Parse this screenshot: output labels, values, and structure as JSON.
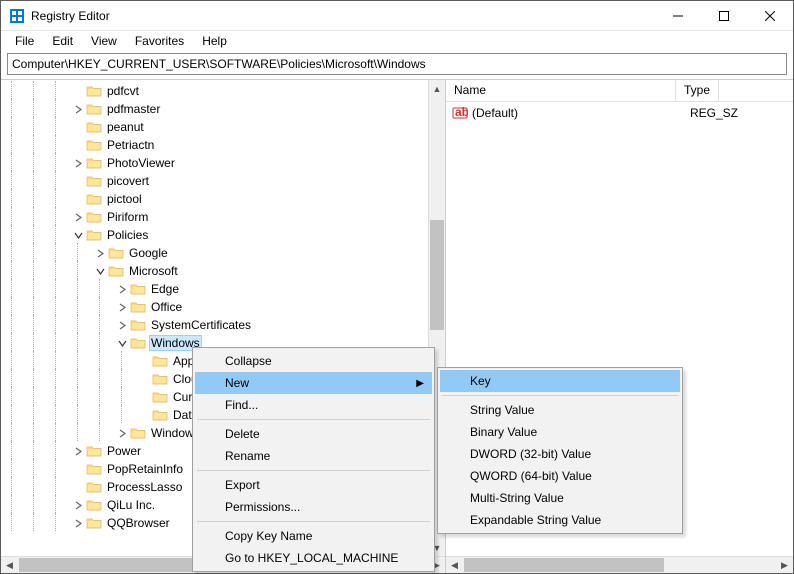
{
  "title": "Registry Editor",
  "menu": [
    "File",
    "Edit",
    "View",
    "Favorites",
    "Help"
  ],
  "address": "Computer\\HKEY_CURRENT_USER\\SOFTWARE\\Policies\\Microsoft\\Windows",
  "tree": [
    {
      "d": 3,
      "t": "",
      "n": "pdfcvt"
    },
    {
      "d": 3,
      "t": ">",
      "n": "pdfmaster"
    },
    {
      "d": 3,
      "t": "",
      "n": "peanut"
    },
    {
      "d": 3,
      "t": "",
      "n": "Petriactn"
    },
    {
      "d": 3,
      "t": ">",
      "n": "PhotoViewer"
    },
    {
      "d": 3,
      "t": "",
      "n": "picovert"
    },
    {
      "d": 3,
      "t": "",
      "n": "pictool"
    },
    {
      "d": 3,
      "t": ">",
      "n": "Piriform"
    },
    {
      "d": 3,
      "t": "v",
      "n": "Policies"
    },
    {
      "d": 4,
      "t": ">",
      "n": "Google"
    },
    {
      "d": 4,
      "t": "v",
      "n": "Microsoft"
    },
    {
      "d": 5,
      "t": ">",
      "n": "Edge"
    },
    {
      "d": 5,
      "t": ">",
      "n": "Office"
    },
    {
      "d": 5,
      "t": ">",
      "n": "SystemCertificates"
    },
    {
      "d": 5,
      "t": "v",
      "n": "Windows",
      "sel": true
    },
    {
      "d": 6,
      "t": "",
      "n": "AppCo"
    },
    {
      "d": 6,
      "t": "",
      "n": "CloudC"
    },
    {
      "d": 6,
      "t": "",
      "n": "Curren"
    },
    {
      "d": 6,
      "t": "",
      "n": "DataCo"
    },
    {
      "d": 5,
      "t": ">",
      "n": "Windows"
    },
    {
      "d": 3,
      "t": ">",
      "n": "Power"
    },
    {
      "d": 3,
      "t": "",
      "n": "PopRetainInfo"
    },
    {
      "d": 3,
      "t": "",
      "n": "ProcessLasso"
    },
    {
      "d": 3,
      "t": ">",
      "n": "QiLu Inc."
    },
    {
      "d": 3,
      "t": ">",
      "n": "QQBrowser"
    }
  ],
  "list": {
    "columns": [
      "Name",
      "Type"
    ],
    "rows": [
      {
        "name": "(Default)",
        "type": "REG_SZ"
      }
    ]
  },
  "ctx1": [
    {
      "label": "Collapse"
    },
    {
      "label": "New",
      "sub": true,
      "hi": true
    },
    {
      "label": "Find..."
    },
    {
      "sep": true
    },
    {
      "label": "Delete"
    },
    {
      "label": "Rename"
    },
    {
      "sep": true
    },
    {
      "label": "Export"
    },
    {
      "label": "Permissions..."
    },
    {
      "sep": true
    },
    {
      "label": "Copy Key Name"
    },
    {
      "label": "Go to HKEY_LOCAL_MACHINE"
    }
  ],
  "ctx2": [
    {
      "label": "Key",
      "hi": true
    },
    {
      "sep": true
    },
    {
      "label": "String Value"
    },
    {
      "label": "Binary Value"
    },
    {
      "label": "DWORD (32-bit) Value"
    },
    {
      "label": "QWORD (64-bit) Value"
    },
    {
      "label": "Multi-String Value"
    },
    {
      "label": "Expandable String Value"
    }
  ]
}
